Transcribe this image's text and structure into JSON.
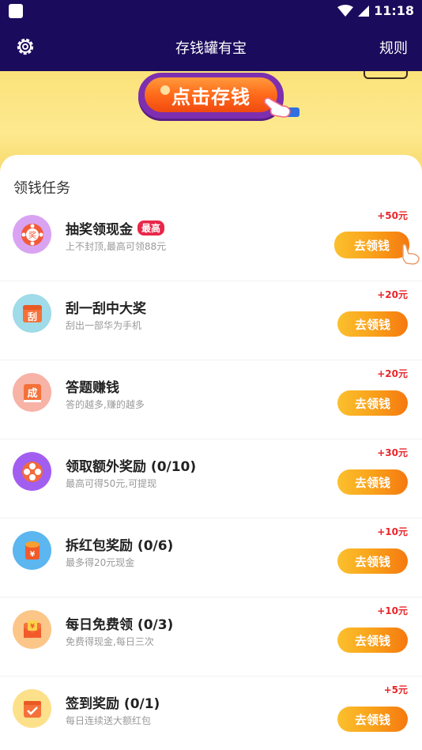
{
  "status_bar": {
    "time": "11:18"
  },
  "app_bar": {
    "title": "存钱罐有宝",
    "rules_label": "规则"
  },
  "hero": {
    "deposit_button_label": "点击存钱"
  },
  "section": {
    "title": "领钱任务"
  },
  "colors": {
    "header_bg": "#1b0b5c",
    "reward_red": "#e8262a",
    "button_orange": "#f9a21b"
  },
  "tasks": [
    {
      "title": "抽奖领现金",
      "badge": "最高",
      "desc": "上不封顶,最高可领88元",
      "reward": "+50元",
      "button": "去领钱",
      "icon": "lottery-wheel-icon"
    },
    {
      "title": "刮一刮中大奖",
      "desc": "刮出一部华为手机",
      "reward": "+20元",
      "button": "去领钱",
      "icon": "scratch-card-icon"
    },
    {
      "title": "答题赚钱",
      "desc": "答的越多,赚的越多",
      "reward": "+20元",
      "button": "去领钱",
      "icon": "quiz-icon"
    },
    {
      "title": "领取额外奖励 (0/10)",
      "desc": "最高可得50元,可提现",
      "reward": "+30元",
      "button": "去领钱",
      "icon": "bonus-reel-icon"
    },
    {
      "title": "拆红包奖励 (0/6)",
      "desc": "最多得20元现金",
      "reward": "+10元",
      "button": "去领钱",
      "icon": "red-packet-icon"
    },
    {
      "title": "每日免费领 (0/3)",
      "desc": "免费得现金,每日三次",
      "reward": "+10元",
      "button": "去领钱",
      "icon": "envelope-yen-icon"
    },
    {
      "title": "签到奖励 (0/1)",
      "desc": "每日连续送大额红包",
      "reward": "+5元",
      "button": "去领钱",
      "icon": "calendar-check-icon"
    }
  ]
}
